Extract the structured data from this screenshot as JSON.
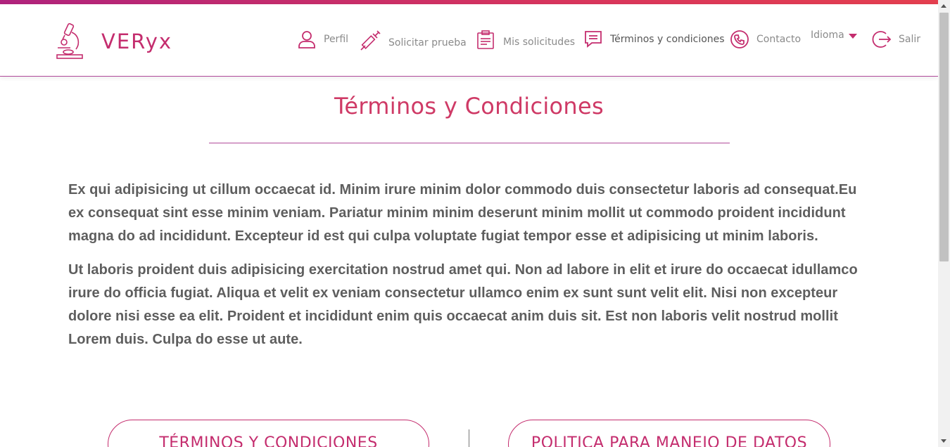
{
  "brand": {
    "name": "VERyx",
    "logo_icon": "microscope-icon",
    "accent_color": "#c42d6e",
    "gradient": [
      "#b0237d",
      "#e43f4f"
    ]
  },
  "nav": {
    "items": [
      {
        "label": "Perfil",
        "icon": "user-icon"
      },
      {
        "label": "Solicitar prueba",
        "icon": "syringe-icon"
      },
      {
        "label": "Mis solicitudes",
        "icon": "clipboard-icon"
      },
      {
        "label": "Términos y condiciones",
        "icon": "message-list-icon"
      },
      {
        "label": "Contacto",
        "icon": "phone-icon"
      },
      {
        "label": "Idioma",
        "icon": "caret-down-icon"
      },
      {
        "label": "Salir",
        "icon": "logout-icon"
      }
    ]
  },
  "page": {
    "title": "Términos y Condiciones",
    "paragraphs": [
      "Ex qui adipisicing ut cillum occaecat id. Minim irure minim dolor commodo duis consectetur laboris ad consequat.Eu ex consequat sint esse minim veniam. Pariatur minim minim deserunt minim mollit ut commodo proident incididunt magna do ad incididunt. Excepteur id est qui culpa voluptate fugiat tempor esse et adipisicing ut minim laboris.",
      "Ut laboris proident duis adipisicing exercitation nostrud amet qui. Non ad labore in elit et irure do occaecat idullamco irure do officia fugiat. Aliqua et velit ex veniam consectetur ullamco enim ex sunt sunt velit elit. Nisi non excepteur dolore nisi esse ea elit. Proident et incididunt enim quis occaecat anim duis sit. Est non laboris velit nostrud mollit Lorem duis. Culpa do esse ut aute."
    ]
  },
  "buttons": {
    "terms": "TÉRMINOS Y CONDICIONES",
    "policy": "POLITICA PARA MANEJO DE DATOS"
  }
}
